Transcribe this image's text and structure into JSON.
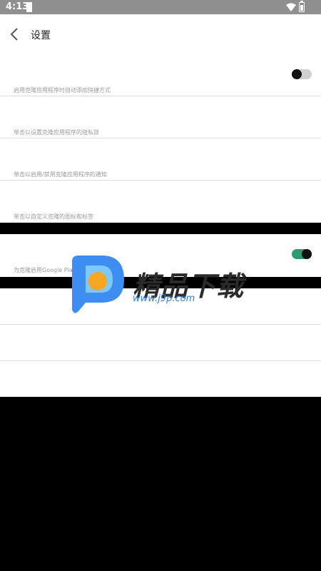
{
  "status_bar": {
    "time": "4:13",
    "icons": [
      "notification-icon",
      "wifi-icon",
      "battery-icon"
    ]
  },
  "header": {
    "back_icon": "chevron-left-icon",
    "title": "设置"
  },
  "settings": [
    {
      "description": "启用克隆应用程序时自动添加快捷方式",
      "toggle": "off"
    },
    {
      "description": "单击以设置克隆应用程序的隐私锁"
    },
    {
      "description": "单击以启用/禁用克隆应用程序的通知"
    },
    {
      "description": "单击以自定义克隆的图标和标签"
    },
    {
      "description": "为克隆启用Google Play",
      "toggle": "on"
    }
  ],
  "watermark": {
    "brand": "精品下载",
    "url": "www.j9p.com",
    "logo": "p-logo"
  },
  "colors": {
    "toggle_on": "#2e9c70",
    "toggle_off": "#cfcfcf",
    "status_bar": "#8f8f8f",
    "description_text": "#9a9a9a"
  }
}
